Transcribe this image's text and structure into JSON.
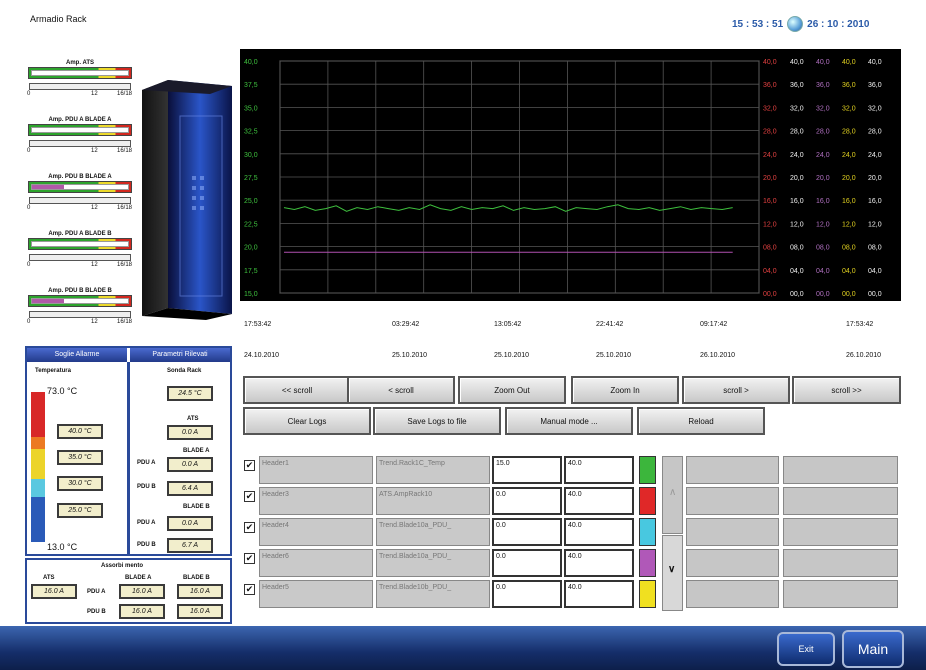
{
  "header": {
    "title": "Armadio Rack",
    "clock_time": "15 : 53 : 51",
    "clock_date": "26 : 10 : 2010"
  },
  "amp_meters": [
    {
      "label": "Amp. ATS",
      "fill": 0.0
    },
    {
      "label": "Amp. PDU A BLADE A",
      "fill": 0.0
    },
    {
      "label": "Amp. PDU B BLADE A",
      "fill": 0.33
    },
    {
      "label": "Amp. PDU A BLADE B",
      "fill": 0.0
    },
    {
      "label": "Amp. PDU B BLADE B",
      "fill": 0.33
    }
  ],
  "amp_scale": {
    "min": "0",
    "mid": "12",
    "max": "16/18"
  },
  "chart_data": {
    "type": "line",
    "yticks_left": [
      "40,0",
      "37,5",
      "35,0",
      "32,5",
      "30,0",
      "27,5",
      "25,0",
      "22,5",
      "20,0",
      "17,5",
      "15,0"
    ],
    "right_axes": [
      {
        "color": "#e04040",
        "ticks": [
          "40,0",
          "36,0",
          "32,0",
          "28,0",
          "24,0",
          "20,0",
          "16,0",
          "12,0",
          "08,0",
          "04,0",
          "00,0"
        ]
      },
      {
        "color": "#f0f0f0",
        "ticks": [
          "40,0",
          "36,0",
          "32,0",
          "28,0",
          "24,0",
          "20,0",
          "16,0",
          "12,0",
          "08,0",
          "04,0",
          "00,0"
        ]
      },
      {
        "color": "#b070c0",
        "ticks": [
          "40,0",
          "36,0",
          "32,0",
          "28,0",
          "24,0",
          "20,0",
          "16,0",
          "12,0",
          "08,0",
          "04,0",
          "00,0"
        ]
      },
      {
        "color": "#e0d020",
        "ticks": [
          "40,0",
          "36,0",
          "32,0",
          "28,0",
          "24,0",
          "20,0",
          "16,0",
          "12,0",
          "08,0",
          "04,0",
          "00,0"
        ]
      },
      {
        "color": "#f0f0f0",
        "ticks": [
          "40,0",
          "36,0",
          "32,0",
          "28,0",
          "24,0",
          "20,0",
          "16,0",
          "12,0",
          "08,0",
          "04,0",
          "00,0"
        ]
      }
    ],
    "x_times": [
      "17:53:42",
      "03:29:42",
      "13:05:42",
      "22:41:42",
      "09:17:42",
      "17:53:42"
    ],
    "x_dates": [
      "24.10.2010",
      "25.10.2010",
      "25.10.2010",
      "25.10.2010",
      "26.10.2010",
      "26.10.2010"
    ],
    "ylim": [
      15,
      40
    ],
    "series": [
      {
        "color": "#3ec03e",
        "values": [
          24.2,
          24.0,
          24.3,
          23.9,
          24.1,
          24.4,
          23.8,
          24.2,
          24.0,
          24.3,
          24.1,
          23.9,
          24.2,
          24.0,
          24.5,
          24.1,
          23.9,
          24.3,
          24.0,
          24.2,
          24.1,
          24.4,
          23.9,
          24.2,
          24.0,
          24.1,
          24.3,
          23.8,
          24.2,
          24.1,
          24.0,
          24.3,
          24.5,
          24.1,
          24.0,
          24.2,
          23.9,
          24.1,
          24.3,
          24.0,
          24.2,
          24.1,
          24.0,
          24.2
        ]
      },
      {
        "color": "#b050b0",
        "values": [
          19.4,
          19.4,
          19.4,
          19.4,
          19.4,
          19.4,
          19.4,
          19.4,
          19.4,
          19.4,
          19.4,
          19.4,
          19.4,
          19.4,
          19.4,
          19.4,
          19.4,
          19.4,
          19.4,
          19.4,
          19.4,
          19.4,
          19.4,
          19.4,
          19.4,
          19.4,
          19.4,
          19.4,
          19.4,
          19.4,
          19.4,
          19.4,
          19.4,
          19.4,
          19.4,
          19.4,
          19.4,
          19.4,
          19.4,
          19.4,
          19.4,
          19.4,
          19.4,
          19.4
        ]
      }
    ]
  },
  "nav_buttons": [
    "<< scroll",
    "< scroll",
    "Zoom Out",
    "Zoom In",
    "scroll >",
    "scroll >>"
  ],
  "log_buttons": [
    "Clear Logs",
    "Save Logs to file",
    "Manual mode ...",
    "Reload"
  ],
  "alarm": {
    "head_left": "Soglie Allarme",
    "head_right": "Parametri Rilevati",
    "temp_label": "Temperatura",
    "temp_max": "73.0 °C",
    "temp_min": "13.0 °C",
    "thresholds": [
      "40.0 °C",
      "35.0 °C",
      "30.0 °C",
      "25.0 °C"
    ],
    "sonda_label": "Sonda Rack",
    "sonda_value": "24.5 °C",
    "ats_label": "ATS",
    "ats_value": "0.0 A",
    "blade_a_label": "BLADE A",
    "blade_b_label": "BLADE B",
    "pdu_a_label": "PDU A",
    "pdu_b_label": "PDU B",
    "blade_a_pdu_a": "0.0 A",
    "blade_a_pdu_b": "6.4 A",
    "blade_b_pdu_a": "0.0 A",
    "blade_b_pdu_b": "6.7 A"
  },
  "absorb": {
    "title": "Assorbi mento",
    "ats_label": "ATS",
    "ats_value": "16.0 A",
    "blade_a_label": "BLADE A",
    "blade_b_label": "BLADE B",
    "pdu_a_label": "PDU A",
    "pdu_b_label": "PDU B",
    "a_pdu_a": "16.0 A",
    "b_pdu_a": "16.0 A",
    "a_pdu_b": "16.0 A",
    "b_pdu_b": "16.0 A"
  },
  "trend_rows": [
    {
      "checked": "✔",
      "header": "Header1",
      "tag": "Trend.Rack1C_Temp",
      "min": "15.0",
      "max": "40.0",
      "color": "#3cb63c"
    },
    {
      "checked": "✔",
      "header": "Header3",
      "tag": "ATS.AmpRack10",
      "min": "0.0",
      "max": "40.0",
      "color": "#e02828"
    },
    {
      "checked": "✔",
      "header": "Header4",
      "tag": "Trend.Blade10a_PDU_",
      "min": "0.0",
      "max": "40.0",
      "color": "#48c8e0"
    },
    {
      "checked": "✔",
      "header": "Header6",
      "tag": "Trend.Blade10a_PDU_",
      "min": "0.0",
      "max": "40.0",
      "color": "#b058b8"
    },
    {
      "checked": "✔",
      "header": "Header5",
      "tag": "Trend.Blade10b_PDU_",
      "min": "0.0",
      "max": "40.0",
      "color": "#f0e020"
    }
  ],
  "scroll_up": "∧",
  "scroll_down": "∨",
  "footer": {
    "exit": "Exit",
    "main": "Main"
  }
}
